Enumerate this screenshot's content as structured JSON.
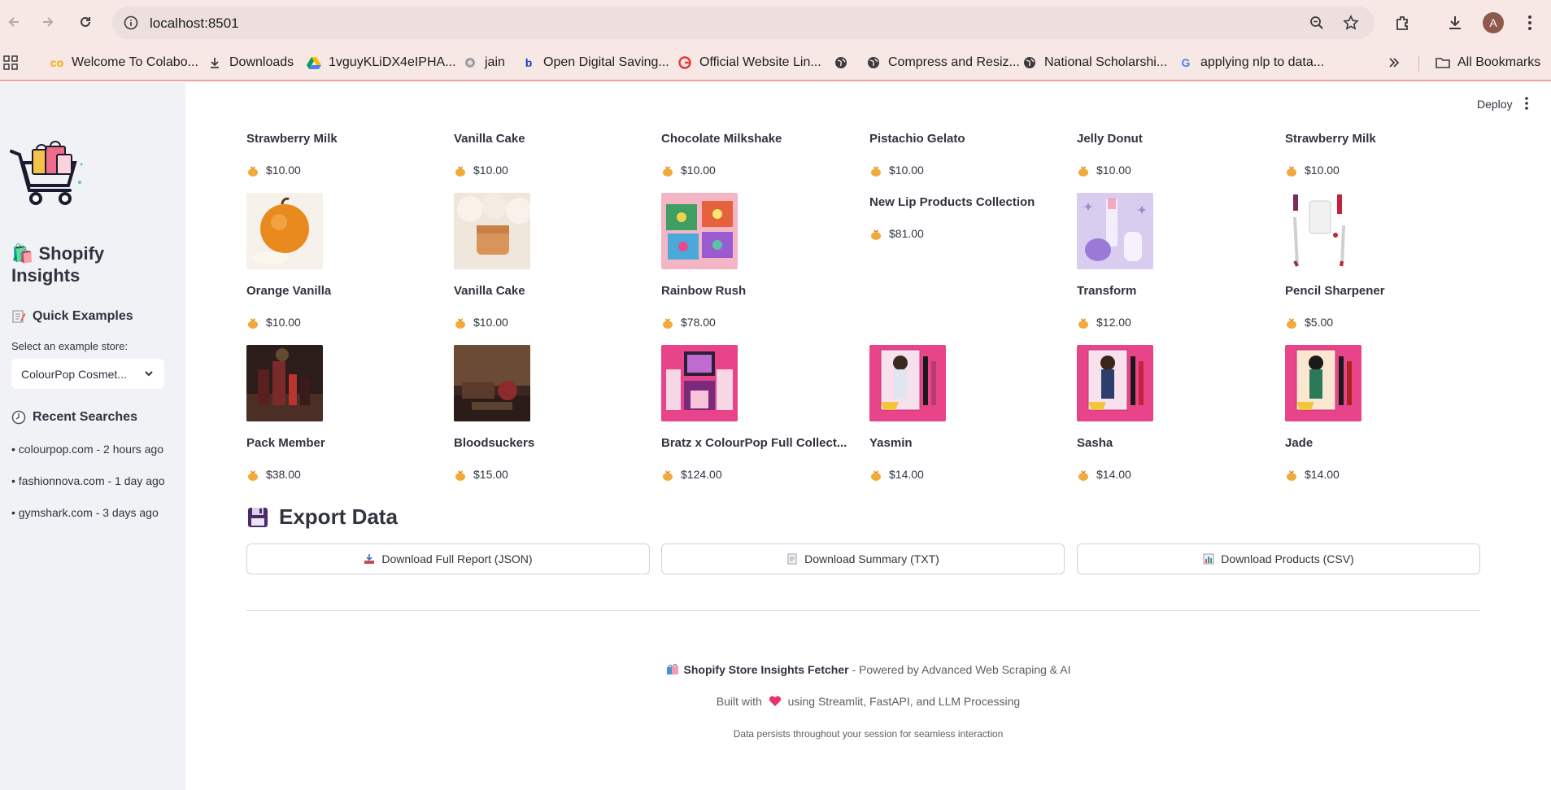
{
  "browser": {
    "url": "localhost:8501",
    "avatar_letter": "A",
    "bookmarks": [
      "Welcome To Colabo...",
      "Downloads",
      "1vguyKLiDX4eIPHA...",
      "jain",
      "Open Digital Saving...",
      "Official Website Lin...",
      "Compress and Resiz...",
      "National Scholarshi...",
      "applying nlp to data..."
    ],
    "all_bookmarks": "All Bookmarks"
  },
  "header": {
    "deploy_label": "Deploy"
  },
  "sidebar": {
    "title": "🛍️ Shopify Insights",
    "quick_examples": "Quick Examples",
    "select_label": "Select an example store:",
    "select_value": "ColourPop Cosmet...",
    "recent_title": "Recent Searches",
    "recent": [
      "• colourpop.com - 2 hours ago",
      "• fashionnova.com - 1 day ago",
      "• gymshark.com - 3 days ago"
    ]
  },
  "products": {
    "row1": [
      {
        "name": "Strawberry Milk",
        "price": "$10.00"
      },
      {
        "name": "Vanilla Cake",
        "price": "$10.00"
      },
      {
        "name": "Chocolate Milkshake",
        "price": "$10.00"
      },
      {
        "name": "Pistachio Gelato",
        "price": "$10.00"
      },
      {
        "name": "Jelly Donut",
        "price": "$10.00"
      },
      {
        "name": "Strawberry Milk",
        "price": "$10.00"
      }
    ],
    "row2": [
      {
        "name": "Orange Vanilla",
        "price": "$10.00"
      },
      {
        "name": "Vanilla Cake",
        "price": "$10.00"
      },
      {
        "name": "Rainbow Rush",
        "price": "$78.00"
      },
      {
        "name": "New Lip Products Collection",
        "price": "$81.00"
      },
      {
        "name": "Transform",
        "price": "$12.00"
      },
      {
        "name": "Pencil Sharpener",
        "price": "$5.00"
      }
    ],
    "row3": [
      {
        "name": "Pack Member",
        "price": "$38.00"
      },
      {
        "name": "Bloodsuckers",
        "price": "$15.00"
      },
      {
        "name": "Bratz x ColourPop Full Collect...",
        "price": "$124.00"
      },
      {
        "name": "Yasmin",
        "price": "$14.00"
      },
      {
        "name": "Sasha",
        "price": "$14.00"
      },
      {
        "name": "Jade",
        "price": "$14.00"
      }
    ]
  },
  "export": {
    "title": "Export Data",
    "buttons": [
      "Download Full Report (JSON)",
      "Download Summary (TXT)",
      "Download Products (CSV)"
    ]
  },
  "footer": {
    "brand": "Shopify Store Insights Fetcher",
    "tagline": " - Powered by Advanced Web Scraping & AI",
    "built_pre": "Built with ",
    "built_post": " using Streamlit, FastAPI, and LLM Processing",
    "persist": "Data persists throughout your session for seamless interaction"
  },
  "colors": {
    "chrome_bg": "#f7e7e5",
    "sidebar_bg": "#f0f2f6",
    "text": "#31333f",
    "accent_line": "#f0a09c"
  }
}
